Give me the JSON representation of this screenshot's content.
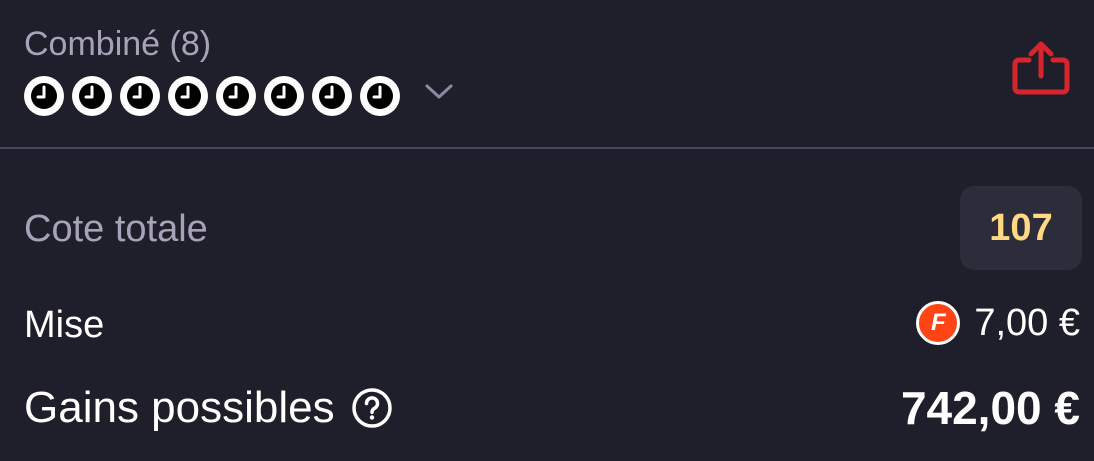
{
  "header": {
    "bet_type": "Combiné (8)",
    "selection_count": 8,
    "selection_status_icon": "clock-icon",
    "expand_icon": "chevron-down-icon",
    "share_icon": "share-icon"
  },
  "odds": {
    "label": "Cote totale",
    "value": "107"
  },
  "stake": {
    "label": "Mise",
    "freebet_badge": "F",
    "value": "7,00 €"
  },
  "winnings": {
    "label": "Gains possibles",
    "help_icon": "help-circle-icon",
    "value": "742,00 €"
  },
  "colors": {
    "background": "#1f1f2b",
    "muted_text": "#a6a3b8",
    "odds_accent": "#ffd983",
    "odds_badge_bg": "#2d2c3a",
    "share_red": "#d8242c",
    "freebet_orange": "#ff4415"
  }
}
